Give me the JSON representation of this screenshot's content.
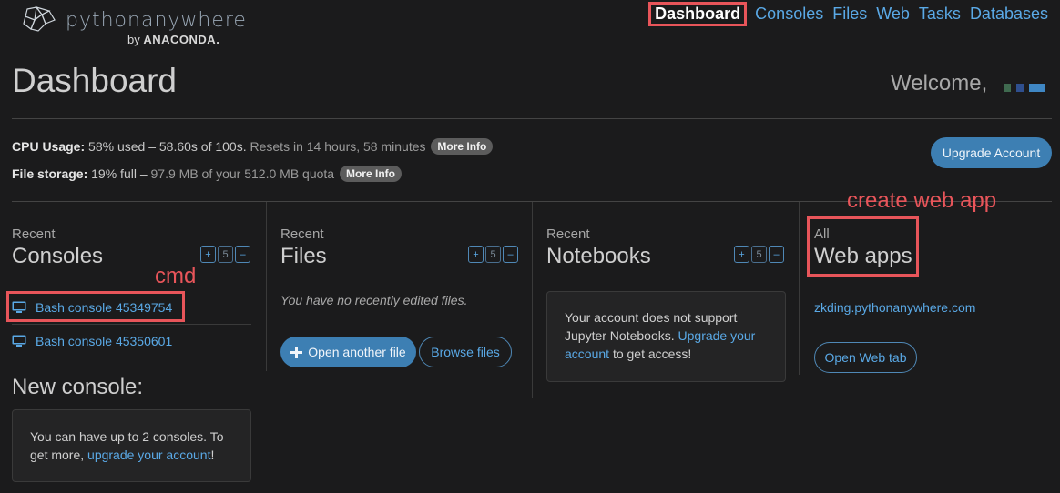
{
  "brand": {
    "name": "pythonanywhere",
    "by": "by",
    "company": "ANACONDA."
  },
  "nav": {
    "items": [
      "Dashboard",
      "Consoles",
      "Files",
      "Web",
      "Tasks",
      "Databases"
    ]
  },
  "page": {
    "title": "Dashboard",
    "welcome": "Welcome,"
  },
  "usage": {
    "cpu_label": "CPU Usage:",
    "cpu_value": "58% used – 58.60s of 100s.",
    "cpu_reset": "Resets in 14 hours, 58 minutes",
    "file_label": "File storage:",
    "file_value": "19% full –",
    "file_detail": "97.9 MB of your 512.0 MB quota",
    "more_info": "More Info",
    "upgrade": "Upgrade Account"
  },
  "consoles": {
    "kicker": "Recent",
    "heading": "Consoles",
    "stepper": [
      "+",
      "5",
      "–"
    ],
    "items": [
      "Bash console 45349754",
      "Bash console 45350601"
    ],
    "new_heading": "New console:",
    "limit_text": "You can have up to 2 consoles. To get more,",
    "limit_link": "upgrade your account",
    "limit_end": "!"
  },
  "files": {
    "kicker": "Recent",
    "heading": "Files",
    "stepper": [
      "+",
      "5",
      "–"
    ],
    "empty": "You have no recently edited files.",
    "open_btn": "Open another file",
    "browse_btn": "Browse files"
  },
  "notebooks": {
    "kicker": "Recent",
    "heading": "Notebooks",
    "stepper": [
      "+",
      "5",
      "–"
    ],
    "msg_start": "Your account does not support Jupyter Notebooks.",
    "msg_link": "Upgrade your account",
    "msg_end": "to get access!"
  },
  "webapps": {
    "kicker": "All",
    "heading": "Web apps",
    "app": "zkding.pythonanywhere.com",
    "open_tab": "Open Web tab"
  },
  "annotations": {
    "cmd": "cmd",
    "create": "create web app"
  },
  "colors": {
    "background": "#1b1b1c",
    "accent": "#3d7fb3",
    "link": "#5aa9e6",
    "annotation": "#e8555a",
    "welcome_squares": [
      "#3f6a4f",
      "#2f4f8e",
      "#3f87c4"
    ]
  }
}
